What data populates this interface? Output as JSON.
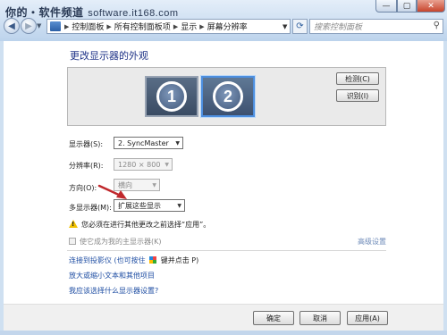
{
  "window": {
    "watermark": "你的・软件频道",
    "watermark_url": "software.it168.com",
    "caption_buttons": [
      "—",
      "▢",
      "✕"
    ]
  },
  "nav": {
    "back_icon": "back-arrow-icon",
    "forward_icon": "forward-arrow-icon",
    "breadcrumbs": [
      "控制面板",
      "所有控制面板项",
      "显示",
      "屏幕分辨率"
    ],
    "search_placeholder": "搜索控制面板"
  },
  "main": {
    "title": "更改显示器的外观",
    "monitors": [
      "1",
      "2"
    ],
    "selected_monitor": "2",
    "detect_button": "检测(C)",
    "identify_button": "识别(I)",
    "fields": {
      "display_label": "显示器(S):",
      "display_value": "2. SyncMaster",
      "resolution_label": "分辨率(R):",
      "resolution_value": "1280 × 800",
      "orientation_label": "方向(O):",
      "orientation_value": "横向",
      "multi_label": "多显示器(M):",
      "multi_value": "扩展这些显示"
    },
    "warning": "您必须在进行其他更改之前选择“应用”。",
    "main_display_checkbox": "使它成为我的主显示器(K)",
    "advanced_link": "高级设置",
    "links": {
      "projector_prefix": "连接到投影仪 (也可按住",
      "projector_suffix": "键并点击 P)",
      "text_size": "放大或缩小文本和其他项目",
      "help": "我应该选择什么显示器设置?"
    }
  },
  "footer": {
    "ok": "确定",
    "cancel": "取消",
    "apply": "应用(A)"
  },
  "colors": {
    "title_blue": "#1e3287",
    "link_blue": "#1f4ea3",
    "arrow_red": "#c0282c"
  }
}
